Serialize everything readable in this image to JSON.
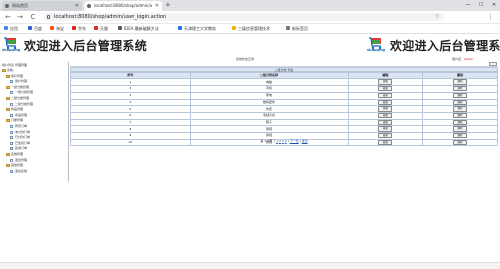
{
  "browser": {
    "tabs": [
      {
        "label": "网站首页",
        "active": false
      },
      {
        "label": "localhost:8080/shop/admin/a",
        "active": true
      }
    ],
    "new_tab": "+",
    "window_controls": [
      "—",
      "☐",
      "✕"
    ],
    "back": "←",
    "forward": "→",
    "reload": "C",
    "url": "localhost:8080/shop/admin/user_login.action",
    "bookmarks": [
      {
        "label": "应用",
        "color": "#4285f4"
      },
      {
        "label": "百度",
        "color": "#2f62d6"
      },
      {
        "label": "淘宝",
        "color": "#ff5000"
      },
      {
        "label": "京东",
        "color": "#e1251b"
      },
      {
        "label": "天猫",
        "color": "#e1251b"
      },
      {
        "label": "IDEA 最新破解方法",
        "color": "#5b5b5b"
      },
      {
        "label": "天津理工大学教务",
        "color": "#1a73e8"
      },
      {
        "label": "三级信息管理技术",
        "color": "#f4b400"
      },
      {
        "label": "新标签页",
        "color": "#777777"
      }
    ]
  },
  "header": {
    "logo_text": "shopping",
    "title": "欢迎进入后台管理系统",
    "title_right": "欢迎进入后台管理系统"
  },
  "infobar": {
    "center_text": "系统状态正常",
    "user_label": "用户名：",
    "user_name": "admin"
  },
  "sidebar": {
    "header": "用户列表  管理界面",
    "items": [
      {
        "label": "系统",
        "type": "folder",
        "indent": 0
      },
      {
        "label": "用户管理",
        "type": "folder",
        "indent": 1
      },
      {
        "label": "用户管理",
        "type": "doc",
        "indent": 2
      },
      {
        "label": "一级分类管理",
        "type": "folder",
        "indent": 1
      },
      {
        "label": "一级分类管理",
        "type": "doc",
        "indent": 2
      },
      {
        "label": "二级分类管理",
        "type": "folder",
        "indent": 1
      },
      {
        "label": "二级分类管理",
        "type": "doc",
        "indent": 2
      },
      {
        "label": "商品管理",
        "type": "folder",
        "indent": 1
      },
      {
        "label": "商品管理",
        "type": "doc",
        "indent": 2
      },
      {
        "label": "订单管理",
        "type": "folder",
        "indent": 1
      },
      {
        "label": "所有订单",
        "type": "doc",
        "indent": 2
      },
      {
        "label": "未付款订单",
        "type": "doc",
        "indent": 2
      },
      {
        "label": "已付款订单",
        "type": "doc",
        "indent": 2
      },
      {
        "label": "已发货订单",
        "type": "doc",
        "indent": 2
      },
      {
        "label": "完成订单",
        "type": "doc",
        "indent": 2
      },
      {
        "label": "系统管理",
        "type": "folder",
        "indent": 1
      },
      {
        "label": "退出管理",
        "type": "doc",
        "indent": 2
      },
      {
        "label": "其他管理",
        "type": "folder",
        "indent": 1
      },
      {
        "label": "退出系统",
        "type": "doc",
        "indent": 2
      }
    ]
  },
  "table": {
    "title": "二级分类 列表",
    "columns": [
      "序号",
      "二级分类名称",
      "编辑",
      "删除"
    ],
    "edit_label": "编辑",
    "delete_label": "删除",
    "rows": [
      {
        "id": "1",
        "name": "电脑"
      },
      {
        "id": "2",
        "name": "手机"
      },
      {
        "id": "3",
        "name": "家电"
      },
      {
        "id": "4",
        "name": "数码配件"
      },
      {
        "id": "5",
        "name": "外套"
      },
      {
        "id": "6",
        "name": "毛绒大衣"
      },
      {
        "id": "7",
        "name": "裤子"
      },
      {
        "id": "8",
        "name": "男鞋"
      },
      {
        "id": "9",
        "name": "男鞋"
      },
      {
        "id": "10",
        "name": "女鞋"
      }
    ],
    "pager": {
      "summary": "第 1/4页",
      "pages": [
        "1",
        "2",
        "3",
        "4"
      ],
      "next": "下一页",
      "last": "尾页"
    }
  }
}
